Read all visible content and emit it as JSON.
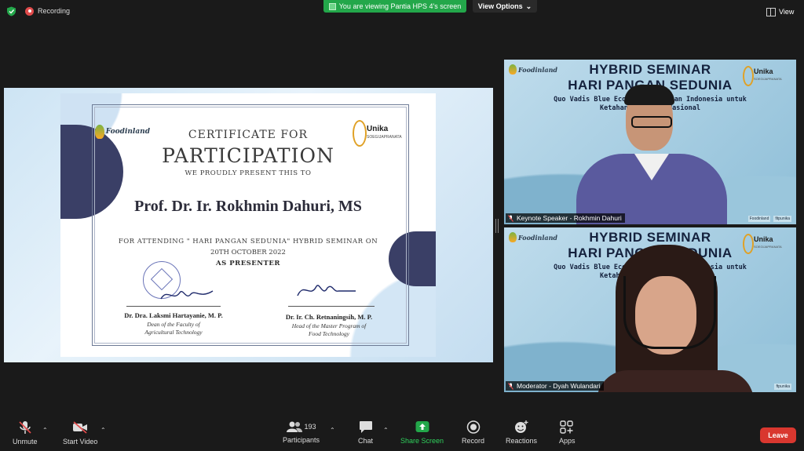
{
  "topbar": {
    "recording_label": "Recording",
    "viewing_banner": "You are viewing Pantia HPS 4's screen",
    "view_options_label": "View Options",
    "view_label": "View"
  },
  "certificate": {
    "logo_left_text": "Foodinland",
    "logo_right_text": "Unika",
    "logo_right_sub": "SOEGIJAPRANATA",
    "title_line1": "CERTIFICATE FOR",
    "title_line2": "PARTICIPATION",
    "presented": "WE PROUDLY PRESENT THIS TO",
    "recipient": "Prof. Dr. Ir. Rokhmin Dahuri, MS",
    "line1": "FOR ATTENDING \" HARI PANGAN SEDUNIA\" HYBRID SEMINAR ON",
    "line2": "20TH OCTOBER 2022",
    "line3": "AS PRESENTER",
    "signer1_name": "Dr. Dra. Laksmi Hartayanie, M. P.",
    "signer1_role_1": "Dean of the Faculty of",
    "signer1_role_2": "Agricultural Technology",
    "signer2_name": "Dr. Ir. Ch. Retnaningsih, M. P.",
    "signer2_role_1": "Head of the Master Program of",
    "signer2_role_2": "Food Technology"
  },
  "tiles": [
    {
      "heading1": "HYBRID SEMINAR",
      "heading2": "HARI PANGAN SEDUNIA",
      "sub1": "Quo Vadis Blue Economy Perikanan Indonesia untuk",
      "sub2": "Ketahanan Pangan Nasional",
      "logo_left": "Foodinland",
      "logo_right": "Unika",
      "logo_right_sub": "SOEGIJAPRANATA",
      "label": "Keynote Speaker - Rokhmin Dahuri",
      "footer_tags": [
        "Foodinland",
        "fitpunika"
      ]
    },
    {
      "heading1": "HYBRID SEMINAR",
      "heading2": "HARI PANGAN SEDUNIA",
      "sub1": "Quo Vadis Blue Economy Perikanan Indonesia untuk",
      "sub2": "Ketahanan Pangan Nasional",
      "logo_left": "Foodinland",
      "logo_right": "Unika",
      "logo_right_sub": "SOEGIJAPRANATA",
      "label": "Moderator - Dyah Wulandari",
      "footer_tags": [
        "ftpunika"
      ]
    }
  ],
  "toolbar": {
    "unmute": "Unmute",
    "start_video": "Start Video",
    "participants": "Participants",
    "participants_count": "193",
    "chat": "Chat",
    "share_screen": "Share Screen",
    "record": "Record",
    "reactions": "Reactions",
    "apps": "Apps",
    "leave": "Leave"
  },
  "colors": {
    "share_green": "#23a74a",
    "leave_red": "#d9372f",
    "recording_red": "#e04b4b",
    "background": "#1a1a1a"
  }
}
